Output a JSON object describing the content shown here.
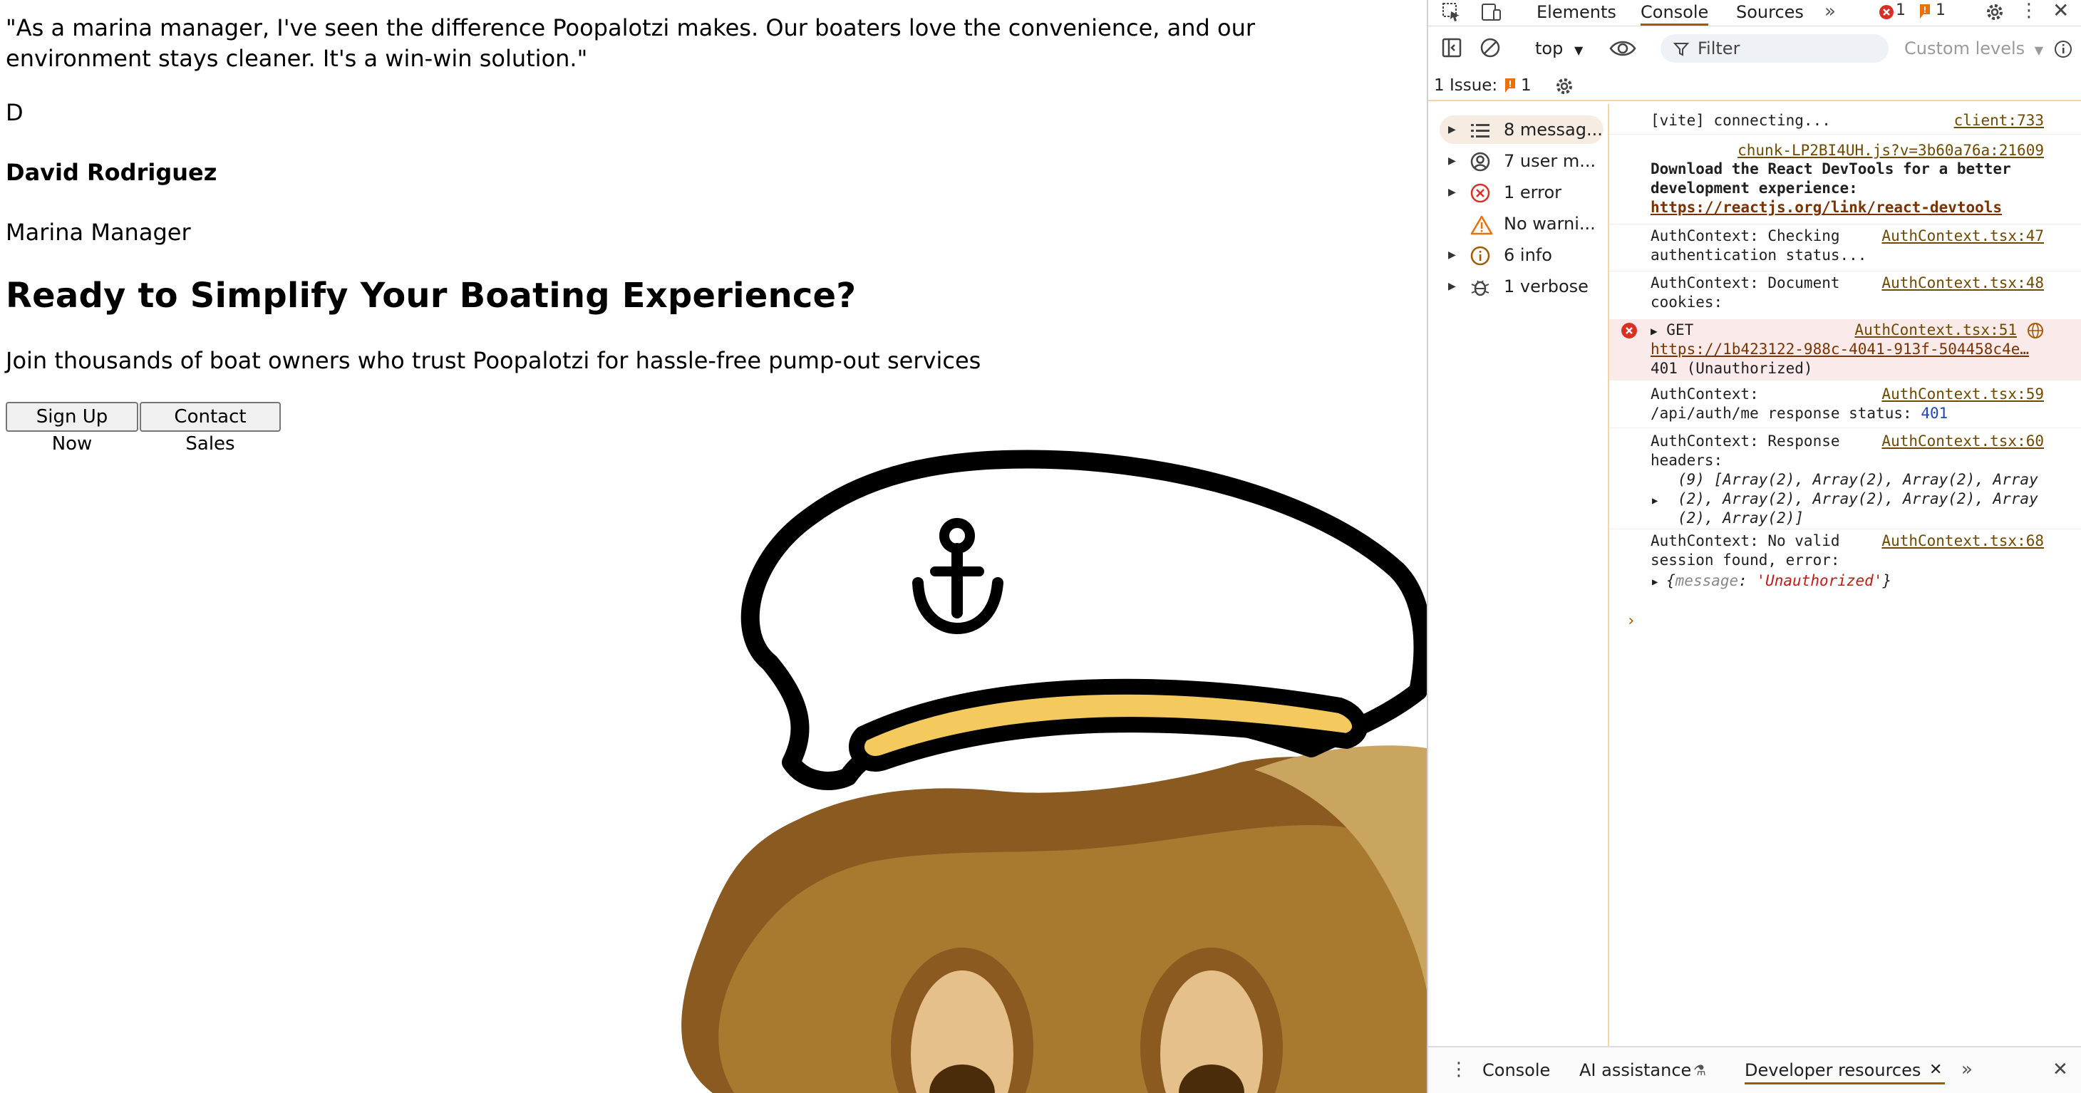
{
  "page": {
    "quote": "\"As a marina manager, I've seen the difference Poopalotzi makes. Our boaters love the convenience, and our environment stays cleaner. It's a win-win solution.\"",
    "avatar_initial": "D",
    "author_name": "David Rodriguez",
    "author_role": "Marina Manager",
    "cta_heading": "Ready to Simplify Your Boating Experience?",
    "cta_subtext": "Join thousands of boat owners who trust Poopalotzi for hassle-free pump-out services",
    "buttons": {
      "signup": "Sign Up Now",
      "contact": "Contact Sales"
    },
    "mascot_icon": "poop-captain-mascot-image"
  },
  "devtools": {
    "tabs": {
      "elements": "Elements",
      "console": "Console",
      "sources": "Sources"
    },
    "badges": {
      "errors": "1",
      "warnings": "1"
    },
    "toolbar": {
      "context": "top",
      "filter_placeholder": "Filter",
      "levels": "Custom levels"
    },
    "issues": {
      "label": "1 Issue:",
      "count": "1"
    },
    "sidebar": [
      {
        "label": "8 messag...",
        "icon": "list-icon"
      },
      {
        "label": "7 user m...",
        "icon": "user-icon"
      },
      {
        "label": "1 error",
        "icon": "error-icon"
      },
      {
        "label": "No warni...",
        "icon": "warning-icon"
      },
      {
        "label": "6 info",
        "icon": "info-icon"
      },
      {
        "label": "1 verbose",
        "icon": "bug-icon"
      }
    ],
    "logs": {
      "vite": {
        "msg": "[vite] connecting...",
        "src": "client:733"
      },
      "react": {
        "src": "chunk-LP2BI4UH.js?v=3b60a76a:21609",
        "line1": "Download the React DevTools for a better",
        "line2": "development experience:",
        "link": "https://reactjs.org/link/react-devtools"
      },
      "auth47": {
        "line1": "AuthContext: Checking",
        "line2": "authentication status...",
        "src": "AuthContext.tsx:47"
      },
      "auth48": {
        "line1": "AuthContext: Document",
        "line2": "cookies:",
        "src": "AuthContext.tsx:48"
      },
      "error": {
        "method": "GET",
        "src": "AuthContext.tsx:51",
        "url": "https://1b423122-988c-4041-913f-504458c4e…",
        "status": "401 (Unauthorized)"
      },
      "auth59": {
        "line1": "AuthContext:",
        "line2": "/api/auth/me response status:",
        "value": "401",
        "src": "AuthContext.tsx:59"
      },
      "auth60": {
        "line1": "AuthContext: Response",
        "line2": "headers:",
        "arr1": "(9) [Array(2), Array(2), Array(2), Array",
        "arr2": "(2), Array(2), Array(2), Array(2), Array",
        "arr3": "(2), Array(2)]",
        "src": "AuthContext.tsx:60"
      },
      "auth68": {
        "line1": "AuthContext: No valid",
        "line2": "session found, error:",
        "obj_open": "{",
        "obj_key": "message",
        "obj_colon": ": ",
        "obj_val": "'Unauthorized'",
        "obj_close": "}",
        "src": "AuthContext.tsx:68"
      }
    },
    "bottom_tabs": {
      "console": "Console",
      "ai": "AI assistance",
      "resources": "Developer resources"
    }
  }
}
